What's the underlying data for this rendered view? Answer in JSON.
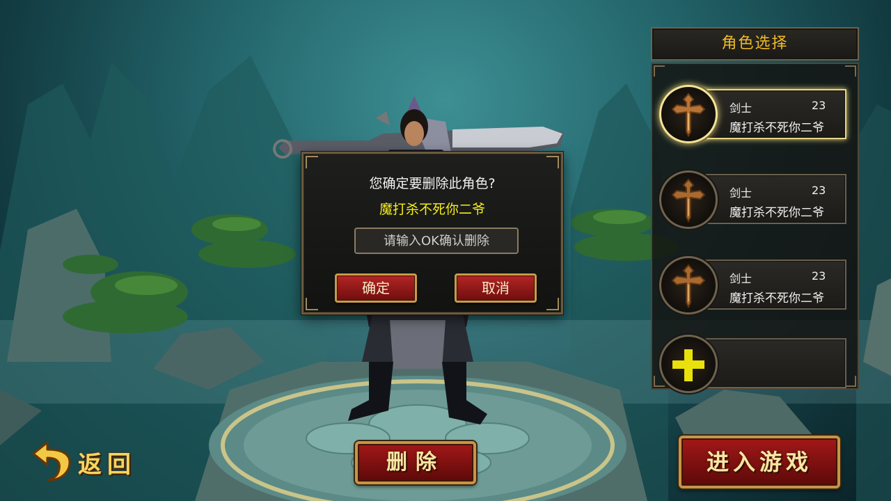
{
  "panel": {
    "title": "角色选择",
    "slots": [
      {
        "class": "剑士",
        "level": "23",
        "name": "魔打杀不死你二爷",
        "selected": true,
        "emblem": "sword-emblem-icon"
      },
      {
        "class": "剑士",
        "level": "23",
        "name": "魔打杀不死你二爷",
        "selected": false,
        "emblem": "sword-emblem-icon"
      },
      {
        "class": "剑士",
        "level": "23",
        "name": "魔打杀不死你二爷",
        "selected": false,
        "emblem": "sword-emblem-icon"
      },
      {
        "empty": true,
        "emblem": "plus-icon"
      }
    ]
  },
  "dialog": {
    "question": "您确定要删除此角色?",
    "character_name": "魔打杀不死你二爷",
    "input_placeholder": "请输入OK确认删除",
    "confirm_label": "确定",
    "cancel_label": "取消"
  },
  "bottom": {
    "back_label": "返回",
    "delete_label": "删除",
    "enter_label": "进入游戏"
  },
  "colors": {
    "accent_gold": "#f0bb28",
    "name_yellow": "#f5ee1a",
    "button_red": "#a31818",
    "plus_yellow": "#e8e10c"
  }
}
